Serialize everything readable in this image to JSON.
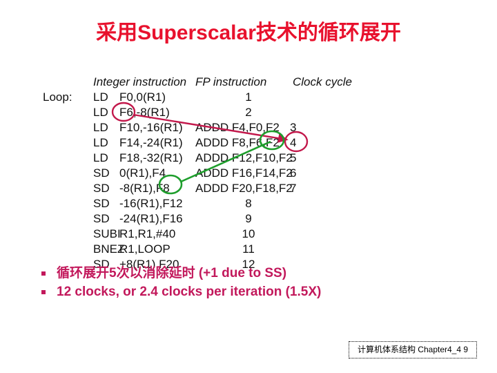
{
  "slide": {
    "title": "采用Superscalar技术的循环展开",
    "title_color": "#e8112d",
    "background": "#ffffff"
  },
  "code_table": {
    "headers": {
      "integer": "Integer instruction",
      "fp": "FP instruction",
      "clock": "Clock cycle"
    },
    "loop_label": "Loop:",
    "rows": [
      {
        "label": "Loop:",
        "op": "LD",
        "args": "F0,0(R1)",
        "fp": "",
        "cycle": "1",
        "cycle_col": "a"
      },
      {
        "label": "",
        "op": "LD",
        "args": "F6,-8(R1)",
        "fp": "",
        "cycle": "2",
        "cycle_col": "a"
      },
      {
        "label": "",
        "op": "LD",
        "args": "F10,-16(R1)",
        "fp": "ADDD F4,F0,F2",
        "cycle": "3",
        "cycle_col": "b"
      },
      {
        "label": "",
        "op": "LD",
        "args": "F14,-24(R1)",
        "fp": "ADDD F8,F6,F2",
        "cycle": "4",
        "cycle_col": "b"
      },
      {
        "label": "",
        "op": "LD",
        "args": "F18,-32(R1)",
        "fp": "ADDD F12,F10,F2",
        "cycle": "5",
        "cycle_col": "b"
      },
      {
        "label": "",
        "op": "SD",
        "args": "0(R1),F4",
        "fp": "ADDD F16,F14,F2",
        "cycle": "6",
        "cycle_col": "b"
      },
      {
        "label": "",
        "op": "SD",
        "args": "-8(R1),F8",
        "fp": "ADDD F20,F18,F2",
        "cycle": "7",
        "cycle_col": "b"
      },
      {
        "label": "",
        "op": "SD",
        "args": "-16(R1),F12",
        "fp": "",
        "cycle": "8",
        "cycle_col": "a"
      },
      {
        "label": "",
        "op": "SD",
        "args": "-24(R1),F16",
        "fp": "",
        "cycle": "9",
        "cycle_col": "a"
      },
      {
        "label": "",
        "op": "SUBI",
        "args": "R1,R1,#40",
        "fp": "",
        "cycle": "10",
        "cycle_col": "a"
      },
      {
        "label": "",
        "op": "BNEZ",
        "args": "R1,LOOP",
        "fp": "",
        "cycle": "11",
        "cycle_col": "a"
      },
      {
        "label": "",
        "op": "SD",
        "args": "+8(R1),F20",
        "fp": "",
        "cycle": "12",
        "cycle_col": "a"
      }
    ]
  },
  "bullets": [
    {
      "text": "循环展开5次以消除延时 (+1 due to SS)"
    },
    {
      "text": "12 clocks, or 2.4 clocks per iteration (1.5X)"
    }
  ],
  "bullet_color": "#c2185b",
  "annotations": {
    "red_color": "#c2184b",
    "green_color": "#1e9e2c",
    "red_circle_source_target": "F6",
    "red_circle_dest_target": "4",
    "green_circle_source_target": "F8",
    "green_circle_dest_target": "F2"
  },
  "footer": {
    "text": "计算机体系结构 Chapter4_4  9"
  }
}
